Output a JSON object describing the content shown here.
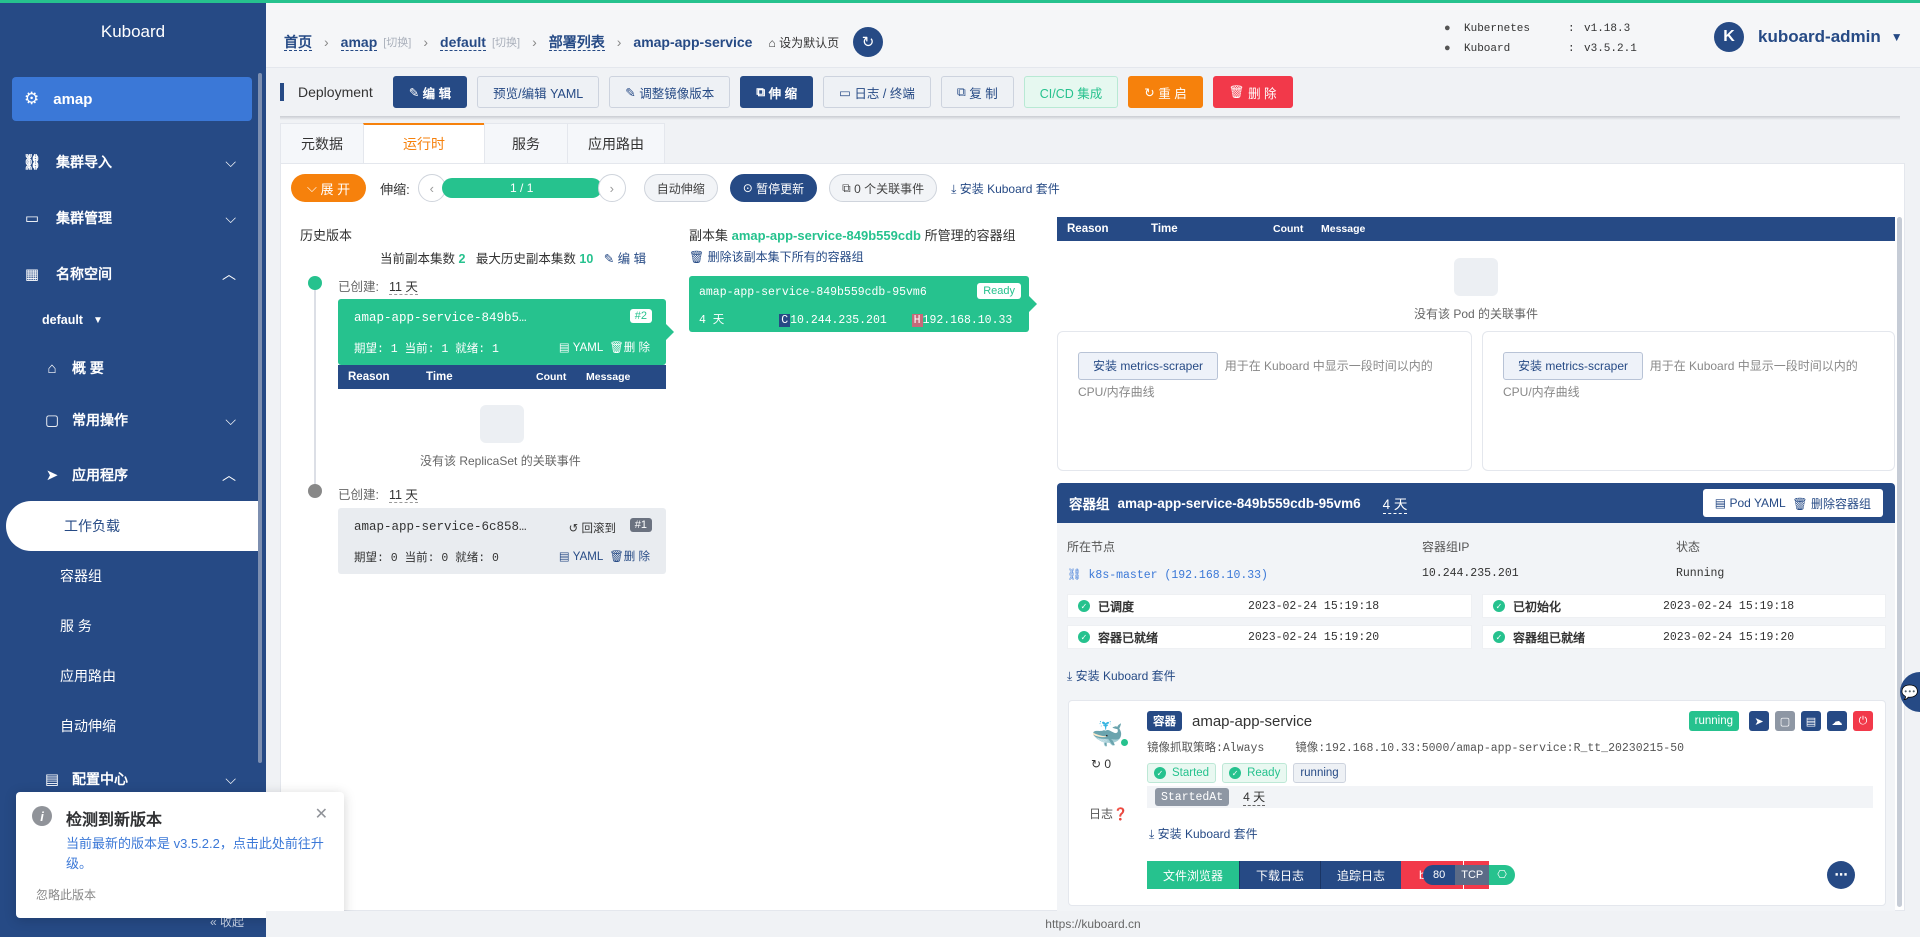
{
  "brand": "Kuboard",
  "sidebar": {
    "namespace_item": "amap",
    "items": [
      {
        "label": "集群导入"
      },
      {
        "label": "集群管理"
      },
      {
        "label": "名称空间"
      }
    ],
    "ns_select": "default",
    "sub": [
      {
        "label": "概 要"
      },
      {
        "label": "常用操作"
      },
      {
        "label": "应用程序"
      }
    ],
    "apps": [
      "工作负载",
      "容器组",
      "服 务",
      "应用路由",
      "自动伸缩"
    ],
    "config": "配置中心",
    "bottom": "收起"
  },
  "breadcrumb": {
    "home": "首页",
    "cluster": "amap",
    "switch1": "[切换]",
    "ns": "default",
    "switch2": "[切换]",
    "list": "部署列表",
    "current": "amap-app-service",
    "set_default": "设为默认页"
  },
  "versions": [
    {
      "key": "Kubernetes",
      "val": "v1.18.3"
    },
    {
      "key": "Kuboard",
      "val": "v3.5.2.1"
    }
  ],
  "user": {
    "initial": "K",
    "name": "kuboard-admin"
  },
  "toolbar": {
    "kind": "Deployment",
    "buttons": [
      "编 辑",
      "预览/编辑 YAML",
      "调整镜像版本",
      "伸 缩",
      "日志 / 终端",
      "复 制",
      "CI/CD 集成",
      "重 启",
      "删 除"
    ]
  },
  "tabs": [
    "元数据",
    "运行时",
    "服务",
    "应用路由"
  ],
  "controls": {
    "expand": "展 开",
    "scale_label": "伸缩:",
    "replicas": "1 / 1",
    "autoscale": "自动伸缩",
    "pause": "暂停更新",
    "events": "0 个关联事件",
    "install": "安装 Kuboard 套件"
  },
  "history": {
    "title": "历史版本",
    "current_count_label": "当前副本集数",
    "current_count": "2",
    "max_count_label": "最大历史副本集数",
    "max_count": "10",
    "edit": "编 辑",
    "created_label": "已创建:",
    "rs1": {
      "created": "11 天",
      "name": "amap-app-service-849b5…",
      "rev": "#2",
      "status": "期望: 1 当前: 1 就绪: 1",
      "yaml": "YAML",
      "del": "删 除"
    },
    "rs2": {
      "created": "11 天",
      "name": "amap-app-service-6c858…",
      "rollback": "回滚到",
      "rev": "#1",
      "status": "期望: 0 当前: 0 就绪: 0",
      "yaml": "YAML",
      "del": "删 除"
    },
    "evt_headers": [
      "Reason",
      "Time",
      "Count",
      "Message"
    ],
    "no_events": "没有该 ReplicaSet 的关联事件"
  },
  "replicaset": {
    "prefix": "副本集",
    "name": "amap-app-service-849b559cdb",
    "suffix": "所管理的容器组",
    "delete_all": "删除该副本集下所有的容器组",
    "pod": {
      "name": "amap-app-service-849b559cdb-95vm6",
      "ready": "Ready",
      "age": "4 天",
      "c": "C",
      "cip": "10.244.235.201",
      "h": "H",
      "hip": "192.168.10.33"
    }
  },
  "events_panel": {
    "headers": [
      "Reason",
      "Time",
      "Count",
      "Message"
    ],
    "empty": "没有该 Pod 的关联事件"
  },
  "metrics": {
    "button": "安装 metrics-scraper",
    "desc": "用于在 Kuboard 中显示一段时间以内的 CPU/内存曲线"
  },
  "pod": {
    "label": "容器组",
    "name": "amap-app-service-849b559cdb-95vm6",
    "age": "4 天",
    "yaml_btn": "Pod YAML",
    "del_btn": "删除容器组",
    "cols": [
      "所在节点",
      "容器组IP",
      "状态"
    ],
    "node": "k8s-master  (192.168.10.33)",
    "ip": "10.244.235.201",
    "status": "Running",
    "conditions": [
      {
        "name": "已调度",
        "time": "2023-02-24 15:19:18"
      },
      {
        "name": "已初始化",
        "time": "2023-02-24 15:19:18"
      },
      {
        "name": "容器已就绪",
        "time": "2023-02-24 15:19:20"
      },
      {
        "name": "容器组已就绪",
        "time": "2023-02-24 15:19:20"
      }
    ],
    "install": "安装 Kuboard 套件"
  },
  "container": {
    "tag": "容器",
    "name": "amap-app-service",
    "running": "running",
    "pull_label": "镜像抓取策略:",
    "pull": "Always",
    "image_label": "镜像:",
    "image": "192.168.10.33:5000/amap-app-service:R_tt_20230215-50",
    "restarts": "0",
    "started": "Started",
    "ready": "Ready",
    "state": "running",
    "started_at_label": "StartedAt",
    "started_at": "4 天",
    "log_label": "日志",
    "install": "安装 Kuboard 套件",
    "actions": [
      "文件浏览器",
      "下载日志",
      "追踪日志",
      "bash"
    ],
    "port": "80",
    "proto": "TCP"
  },
  "notify": {
    "title": "检测到新版本",
    "body": "当前最新的版本是 v3.5.2.2，点击此处前往升级。",
    "ignore": "忽略此版本"
  },
  "footer": "https://kuboard.cn"
}
